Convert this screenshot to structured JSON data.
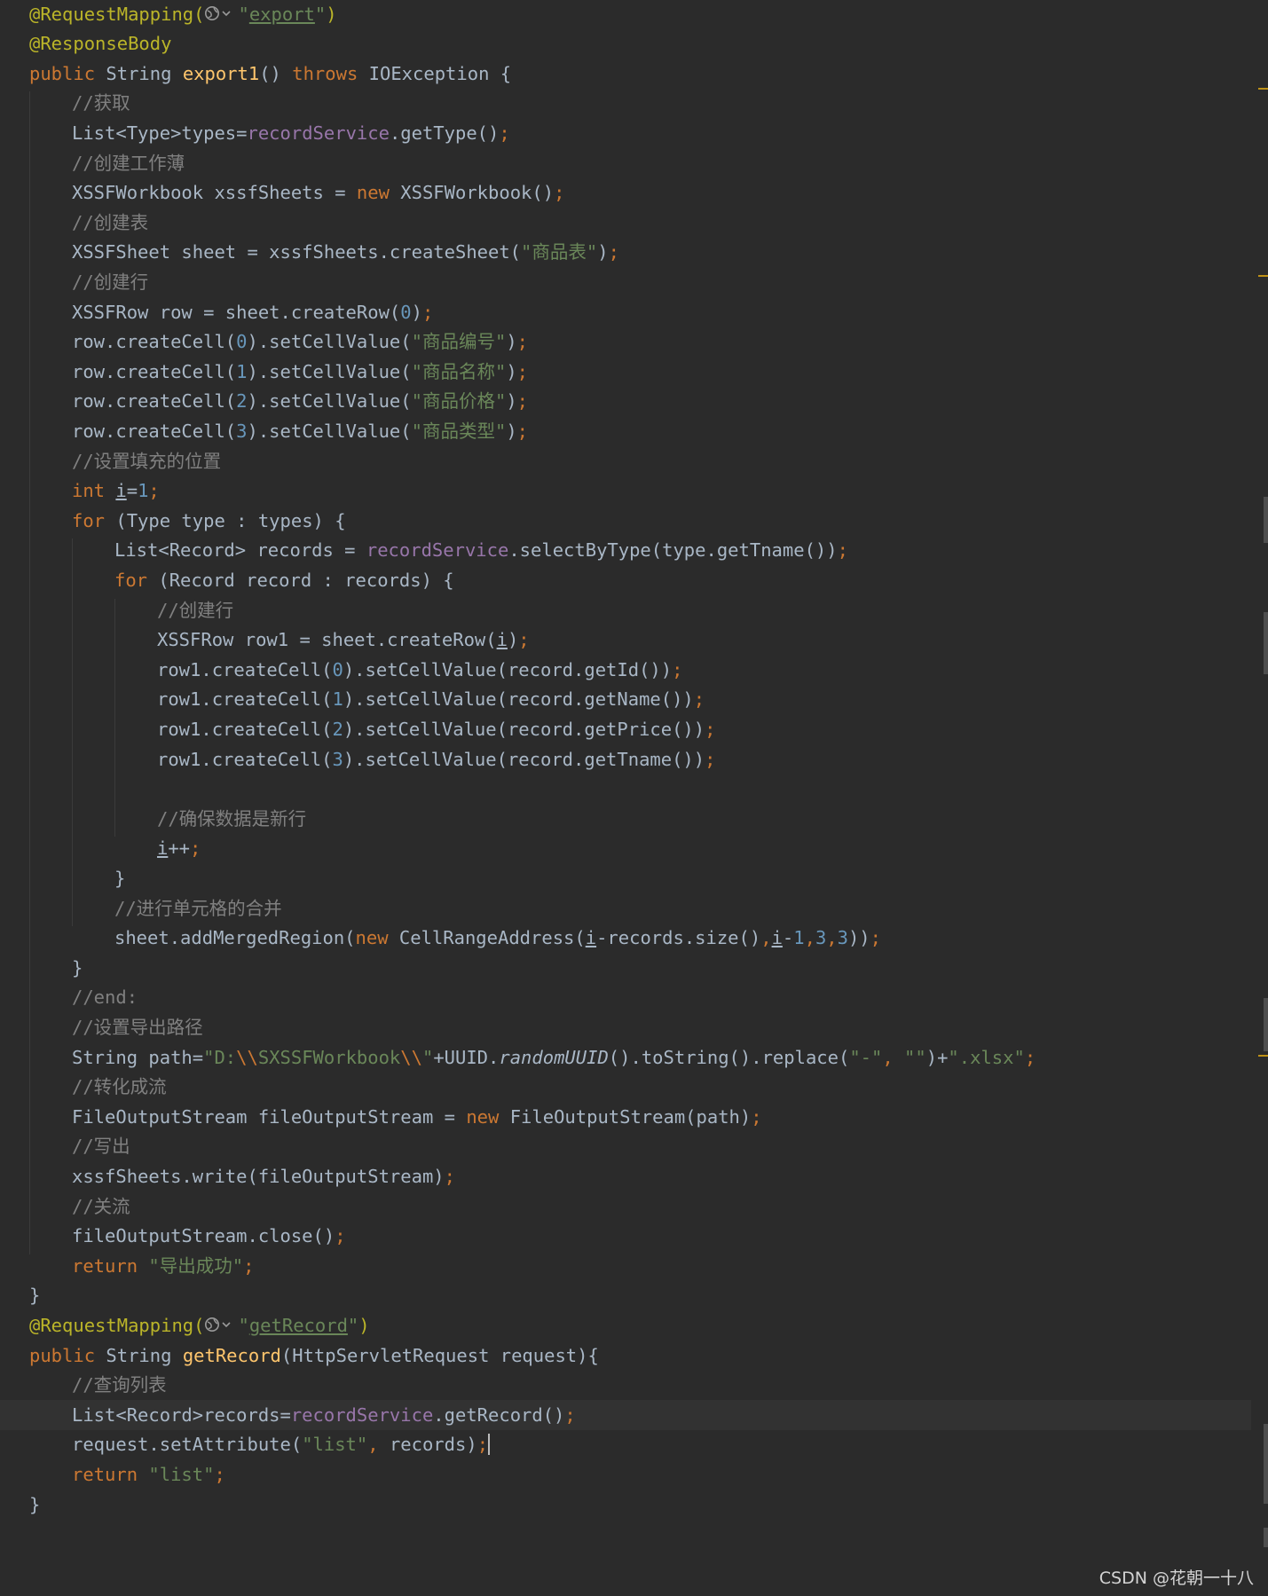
{
  "editor": {
    "language": "java",
    "theme": "darcula",
    "lines": [
      [
        [
          "ann",
          "@RequestMapping("
        ],
        [
          "globe",
          ""
        ],
        [
          "str",
          "\""
        ],
        [
          "str ul",
          "export"
        ],
        [
          "str",
          "\""
        ],
        [
          "ann",
          ")"
        ]
      ],
      [
        [
          "ann",
          "@ResponseBody"
        ]
      ],
      [
        [
          "kw",
          "public "
        ],
        [
          "",
          "String "
        ],
        [
          "fn",
          "export1"
        ],
        [
          "",
          "() "
        ],
        [
          "kw",
          "throws "
        ],
        [
          "",
          "IOException {"
        ]
      ],
      [
        [
          "cmt",
          "//获取"
        ]
      ],
      [
        [
          "",
          "List<Type>types="
        ],
        [
          "fld",
          "recordService"
        ],
        [
          "",
          ".getType()"
        ],
        [
          "op",
          ";"
        ]
      ],
      [
        [
          "cmt",
          "//创建工作薄"
        ]
      ],
      [
        [
          "",
          "XSSFWorkbook xssfSheets = "
        ],
        [
          "kw",
          "new "
        ],
        [
          "",
          "XSSFWorkbook()"
        ],
        [
          "op",
          ";"
        ]
      ],
      [
        [
          "cmt",
          "//创建表"
        ]
      ],
      [
        [
          "",
          "XSSFSheet sheet = xssfSheets.createSheet("
        ],
        [
          "str",
          "\"商品表\""
        ],
        [
          "",
          ")"
        ],
        [
          "op",
          ";"
        ]
      ],
      [
        [
          "cmt",
          "//创建行"
        ]
      ],
      [
        [
          "",
          "XSSFRow row = sheet.createRow("
        ],
        [
          "num",
          "0"
        ],
        [
          "",
          ")"
        ],
        [
          "op",
          ";"
        ]
      ],
      [
        [
          "",
          "row.createCell("
        ],
        [
          "num",
          "0"
        ],
        [
          "",
          ").setCellValue("
        ],
        [
          "str",
          "\"商品编号\""
        ],
        [
          "",
          ")"
        ],
        [
          "op",
          ";"
        ]
      ],
      [
        [
          "",
          "row.createCell("
        ],
        [
          "num",
          "1"
        ],
        [
          "",
          ").setCellValue("
        ],
        [
          "str",
          "\"商品名称\""
        ],
        [
          "",
          ")"
        ],
        [
          "op",
          ";"
        ]
      ],
      [
        [
          "",
          "row.createCell("
        ],
        [
          "num",
          "2"
        ],
        [
          "",
          ").setCellValue("
        ],
        [
          "str",
          "\"商品价格\""
        ],
        [
          "",
          ")"
        ],
        [
          "op",
          ";"
        ]
      ],
      [
        [
          "",
          "row.createCell("
        ],
        [
          "num",
          "3"
        ],
        [
          "",
          ").setCellValue("
        ],
        [
          "str",
          "\"商品类型\""
        ],
        [
          "",
          ")"
        ],
        [
          "op",
          ";"
        ]
      ],
      [
        [
          "cmt",
          "//设置填充的位置"
        ]
      ],
      [
        [
          "kw",
          "int "
        ],
        [
          "ul",
          "i"
        ],
        [
          "",
          "="
        ],
        [
          "num",
          "1"
        ],
        [
          "op",
          ";"
        ]
      ],
      [
        [
          "kw",
          "for "
        ],
        [
          "",
          "(Type type : types) {"
        ]
      ],
      [
        [
          "",
          "List<Record> records = "
        ],
        [
          "fld",
          "recordService"
        ],
        [
          "",
          ".selectByType(type.getTname())"
        ],
        [
          "op",
          ";"
        ]
      ],
      [
        [
          "kw",
          "for "
        ],
        [
          "",
          "(Record record : records) {"
        ]
      ],
      [
        [
          "cmt",
          "//创建行"
        ]
      ],
      [
        [
          "",
          "XSSFRow row1 = sheet.createRow("
        ],
        [
          "ul",
          "i"
        ],
        [
          "",
          ")"
        ],
        [
          "op",
          ";"
        ]
      ],
      [
        [
          "",
          "row1.createCell("
        ],
        [
          "num",
          "0"
        ],
        [
          "",
          ").setCellValue(record.getId())"
        ],
        [
          "op",
          ";"
        ]
      ],
      [
        [
          "",
          "row1.createCell("
        ],
        [
          "num",
          "1"
        ],
        [
          "",
          ").setCellValue(record.getName())"
        ],
        [
          "op",
          ";"
        ]
      ],
      [
        [
          "",
          "row1.createCell("
        ],
        [
          "num",
          "2"
        ],
        [
          "",
          ").setCellValue(record.getPrice())"
        ],
        [
          "op",
          ";"
        ]
      ],
      [
        [
          "",
          "row1.createCell("
        ],
        [
          "num",
          "3"
        ],
        [
          "",
          ").setCellValue(record.getTname())"
        ],
        [
          "op",
          ";"
        ]
      ],
      [],
      [
        [
          "cmt",
          "//确保数据是新行"
        ]
      ],
      [
        [
          "ul",
          "i"
        ],
        [
          "",
          "++"
        ],
        [
          "op",
          ";"
        ]
      ],
      [
        [
          "",
          "}"
        ]
      ],
      [
        [
          "cmt",
          "//进行单元格的合并"
        ]
      ],
      [
        [
          "",
          "sheet.addMergedRegion("
        ],
        [
          "kw",
          "new "
        ],
        [
          "",
          "CellRangeAddress("
        ],
        [
          "ul",
          "i"
        ],
        [
          "",
          "-records.size()"
        ],
        [
          "op",
          ","
        ],
        [
          "ul",
          "i"
        ],
        [
          "",
          "-"
        ],
        [
          "num",
          "1"
        ],
        [
          "op",
          ","
        ],
        [
          "num",
          "3"
        ],
        [
          "op",
          ","
        ],
        [
          "num",
          "3"
        ],
        [
          "",
          "))"
        ],
        [
          "op",
          ";"
        ]
      ],
      [
        [
          "",
          "}"
        ]
      ],
      [
        [
          "cmt",
          "//end:"
        ]
      ],
      [
        [
          "cmt",
          "//设置导出路径"
        ]
      ],
      [
        [
          "",
          "String path="
        ],
        [
          "str",
          "\"D:"
        ],
        [
          "kw",
          "\\\\"
        ],
        [
          "str",
          "SXSSFWorkbook"
        ],
        [
          "kw",
          "\\\\"
        ],
        [
          "str",
          "\""
        ],
        [
          "",
          "+UUID."
        ],
        [
          "it",
          "randomUUID"
        ],
        [
          "",
          "().toString().replace("
        ],
        [
          "str",
          "\"-\""
        ],
        [
          "op",
          ", "
        ],
        [
          "str",
          "\"\""
        ],
        [
          "",
          ")+"
        ],
        [
          "str",
          "\".xlsx\""
        ],
        [
          "op",
          ";"
        ]
      ],
      [
        [
          "cmt",
          "//转化成流"
        ]
      ],
      [
        [
          "",
          "FileOutputStream fileOutputStream = "
        ],
        [
          "kw",
          "new "
        ],
        [
          "",
          "FileOutputStream(path)"
        ],
        [
          "op",
          ";"
        ]
      ],
      [
        [
          "cmt",
          "//写出"
        ]
      ],
      [
        [
          "",
          "xssfSheets.write(fileOutputStream)"
        ],
        [
          "op",
          ";"
        ]
      ],
      [
        [
          "cmt",
          "//关流"
        ]
      ],
      [
        [
          "",
          "fileOutputStream.close()"
        ],
        [
          "op",
          ";"
        ]
      ],
      [
        [
          "kw",
          "return "
        ],
        [
          "str",
          "\"导出成功\""
        ],
        [
          "op",
          ";"
        ]
      ],
      [
        [
          "",
          "}"
        ]
      ],
      [
        [
          "ann",
          "@RequestMapping("
        ],
        [
          "globe",
          ""
        ],
        [
          "str",
          "\""
        ],
        [
          "str ul",
          "getRecord"
        ],
        [
          "str",
          "\""
        ],
        [
          "ann",
          ")"
        ]
      ],
      [
        [
          "kw",
          "public "
        ],
        [
          "",
          "String "
        ],
        [
          "fn",
          "getRecord"
        ],
        [
          "",
          "(HttpServletRequest request){"
        ]
      ],
      [
        [
          "cmt",
          "//查询列表"
        ]
      ],
      [
        [
          "",
          "List<Record>records="
        ],
        [
          "fld",
          "recordService"
        ],
        [
          "",
          ".getRecord()"
        ],
        [
          "op",
          ";"
        ]
      ],
      [
        [
          "",
          "request.setAttribute("
        ],
        [
          "str",
          "\"list\""
        ],
        [
          "op",
          ", "
        ],
        [
          "",
          "records)"
        ],
        [
          "op",
          ";"
        ],
        [
          "caret",
          ""
        ]
      ],
      [
        [
          "kw",
          "return "
        ],
        [
          "str",
          "\"list\""
        ],
        [
          "op",
          ";"
        ]
      ],
      [
        [
          "",
          "}"
        ]
      ]
    ],
    "current_line": 47,
    "icons": {
      "globe": "globe-dropdown-icon",
      "caret": "text-cursor"
    }
  },
  "colors": {
    "background": "#2b2b2b",
    "keyword": "#cc7832",
    "annotation": "#bbb529",
    "function": "#ffc66d",
    "string": "#6a8759",
    "comment": "#808080",
    "number": "#6897bb",
    "field": "#9876aa",
    "text": "#a9b7c6",
    "warning_mark": "#be9117"
  },
  "watermark": "CSDN @花朝一十八"
}
